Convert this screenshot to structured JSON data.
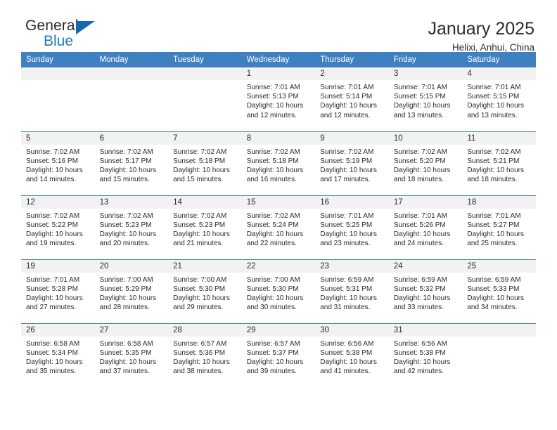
{
  "brand": {
    "name_top": "General",
    "name_bottom": "Blue",
    "triangle_color": "#1668b0",
    "blue_color": "#1f7bc1"
  },
  "header": {
    "title": "January 2025",
    "subtitle": "Helixi, Anhui, China",
    "header_bg": "#3f80c1",
    "header_text": "#ffffff",
    "daynum_bg": "#f2f2f2"
  },
  "weekday_headers": [
    "Sunday",
    "Monday",
    "Tuesday",
    "Wednesday",
    "Thursday",
    "Friday",
    "Saturday"
  ],
  "labels": {
    "sunrise": "Sunrise:",
    "sunset": "Sunset:",
    "daylight": "Daylight:"
  },
  "weeks": [
    [
      {
        "day": "",
        "empty": true
      },
      {
        "day": "",
        "empty": true
      },
      {
        "day": "",
        "empty": true
      },
      {
        "day": "1",
        "sunrise": "Sunrise: 7:01 AM",
        "sunset": "Sunset: 5:13 PM",
        "daylight": "Daylight: 10 hours and 12 minutes."
      },
      {
        "day": "2",
        "sunrise": "Sunrise: 7:01 AM",
        "sunset": "Sunset: 5:14 PM",
        "daylight": "Daylight: 10 hours and 12 minutes."
      },
      {
        "day": "3",
        "sunrise": "Sunrise: 7:01 AM",
        "sunset": "Sunset: 5:15 PM",
        "daylight": "Daylight: 10 hours and 13 minutes."
      },
      {
        "day": "4",
        "sunrise": "Sunrise: 7:01 AM",
        "sunset": "Sunset: 5:15 PM",
        "daylight": "Daylight: 10 hours and 13 minutes."
      }
    ],
    [
      {
        "day": "5",
        "sunrise": "Sunrise: 7:02 AM",
        "sunset": "Sunset: 5:16 PM",
        "daylight": "Daylight: 10 hours and 14 minutes."
      },
      {
        "day": "6",
        "sunrise": "Sunrise: 7:02 AM",
        "sunset": "Sunset: 5:17 PM",
        "daylight": "Daylight: 10 hours and 15 minutes."
      },
      {
        "day": "7",
        "sunrise": "Sunrise: 7:02 AM",
        "sunset": "Sunset: 5:18 PM",
        "daylight": "Daylight: 10 hours and 15 minutes."
      },
      {
        "day": "8",
        "sunrise": "Sunrise: 7:02 AM",
        "sunset": "Sunset: 5:18 PM",
        "daylight": "Daylight: 10 hours and 16 minutes."
      },
      {
        "day": "9",
        "sunrise": "Sunrise: 7:02 AM",
        "sunset": "Sunset: 5:19 PM",
        "daylight": "Daylight: 10 hours and 17 minutes."
      },
      {
        "day": "10",
        "sunrise": "Sunrise: 7:02 AM",
        "sunset": "Sunset: 5:20 PM",
        "daylight": "Daylight: 10 hours and 18 minutes."
      },
      {
        "day": "11",
        "sunrise": "Sunrise: 7:02 AM",
        "sunset": "Sunset: 5:21 PM",
        "daylight": "Daylight: 10 hours and 18 minutes."
      }
    ],
    [
      {
        "day": "12",
        "sunrise": "Sunrise: 7:02 AM",
        "sunset": "Sunset: 5:22 PM",
        "daylight": "Daylight: 10 hours and 19 minutes."
      },
      {
        "day": "13",
        "sunrise": "Sunrise: 7:02 AM",
        "sunset": "Sunset: 5:23 PM",
        "daylight": "Daylight: 10 hours and 20 minutes."
      },
      {
        "day": "14",
        "sunrise": "Sunrise: 7:02 AM",
        "sunset": "Sunset: 5:23 PM",
        "daylight": "Daylight: 10 hours and 21 minutes."
      },
      {
        "day": "15",
        "sunrise": "Sunrise: 7:02 AM",
        "sunset": "Sunset: 5:24 PM",
        "daylight": "Daylight: 10 hours and 22 minutes."
      },
      {
        "day": "16",
        "sunrise": "Sunrise: 7:01 AM",
        "sunset": "Sunset: 5:25 PM",
        "daylight": "Daylight: 10 hours and 23 minutes."
      },
      {
        "day": "17",
        "sunrise": "Sunrise: 7:01 AM",
        "sunset": "Sunset: 5:26 PM",
        "daylight": "Daylight: 10 hours and 24 minutes."
      },
      {
        "day": "18",
        "sunrise": "Sunrise: 7:01 AM",
        "sunset": "Sunset: 5:27 PM",
        "daylight": "Daylight: 10 hours and 25 minutes."
      }
    ],
    [
      {
        "day": "19",
        "sunrise": "Sunrise: 7:01 AM",
        "sunset": "Sunset: 5:28 PM",
        "daylight": "Daylight: 10 hours and 27 minutes."
      },
      {
        "day": "20",
        "sunrise": "Sunrise: 7:00 AM",
        "sunset": "Sunset: 5:29 PM",
        "daylight": "Daylight: 10 hours and 28 minutes."
      },
      {
        "day": "21",
        "sunrise": "Sunrise: 7:00 AM",
        "sunset": "Sunset: 5:30 PM",
        "daylight": "Daylight: 10 hours and 29 minutes."
      },
      {
        "day": "22",
        "sunrise": "Sunrise: 7:00 AM",
        "sunset": "Sunset: 5:30 PM",
        "daylight": "Daylight: 10 hours and 30 minutes."
      },
      {
        "day": "23",
        "sunrise": "Sunrise: 6:59 AM",
        "sunset": "Sunset: 5:31 PM",
        "daylight": "Daylight: 10 hours and 31 minutes."
      },
      {
        "day": "24",
        "sunrise": "Sunrise: 6:59 AM",
        "sunset": "Sunset: 5:32 PM",
        "daylight": "Daylight: 10 hours and 33 minutes."
      },
      {
        "day": "25",
        "sunrise": "Sunrise: 6:59 AM",
        "sunset": "Sunset: 5:33 PM",
        "daylight": "Daylight: 10 hours and 34 minutes."
      }
    ],
    [
      {
        "day": "26",
        "sunrise": "Sunrise: 6:58 AM",
        "sunset": "Sunset: 5:34 PM",
        "daylight": "Daylight: 10 hours and 35 minutes."
      },
      {
        "day": "27",
        "sunrise": "Sunrise: 6:58 AM",
        "sunset": "Sunset: 5:35 PM",
        "daylight": "Daylight: 10 hours and 37 minutes."
      },
      {
        "day": "28",
        "sunrise": "Sunrise: 6:57 AM",
        "sunset": "Sunset: 5:36 PM",
        "daylight": "Daylight: 10 hours and 38 minutes."
      },
      {
        "day": "29",
        "sunrise": "Sunrise: 6:57 AM",
        "sunset": "Sunset: 5:37 PM",
        "daylight": "Daylight: 10 hours and 39 minutes."
      },
      {
        "day": "30",
        "sunrise": "Sunrise: 6:56 AM",
        "sunset": "Sunset: 5:38 PM",
        "daylight": "Daylight: 10 hours and 41 minutes."
      },
      {
        "day": "31",
        "sunrise": "Sunrise: 6:56 AM",
        "sunset": "Sunset: 5:38 PM",
        "daylight": "Daylight: 10 hours and 42 minutes."
      },
      {
        "day": "",
        "empty": true
      }
    ]
  ]
}
